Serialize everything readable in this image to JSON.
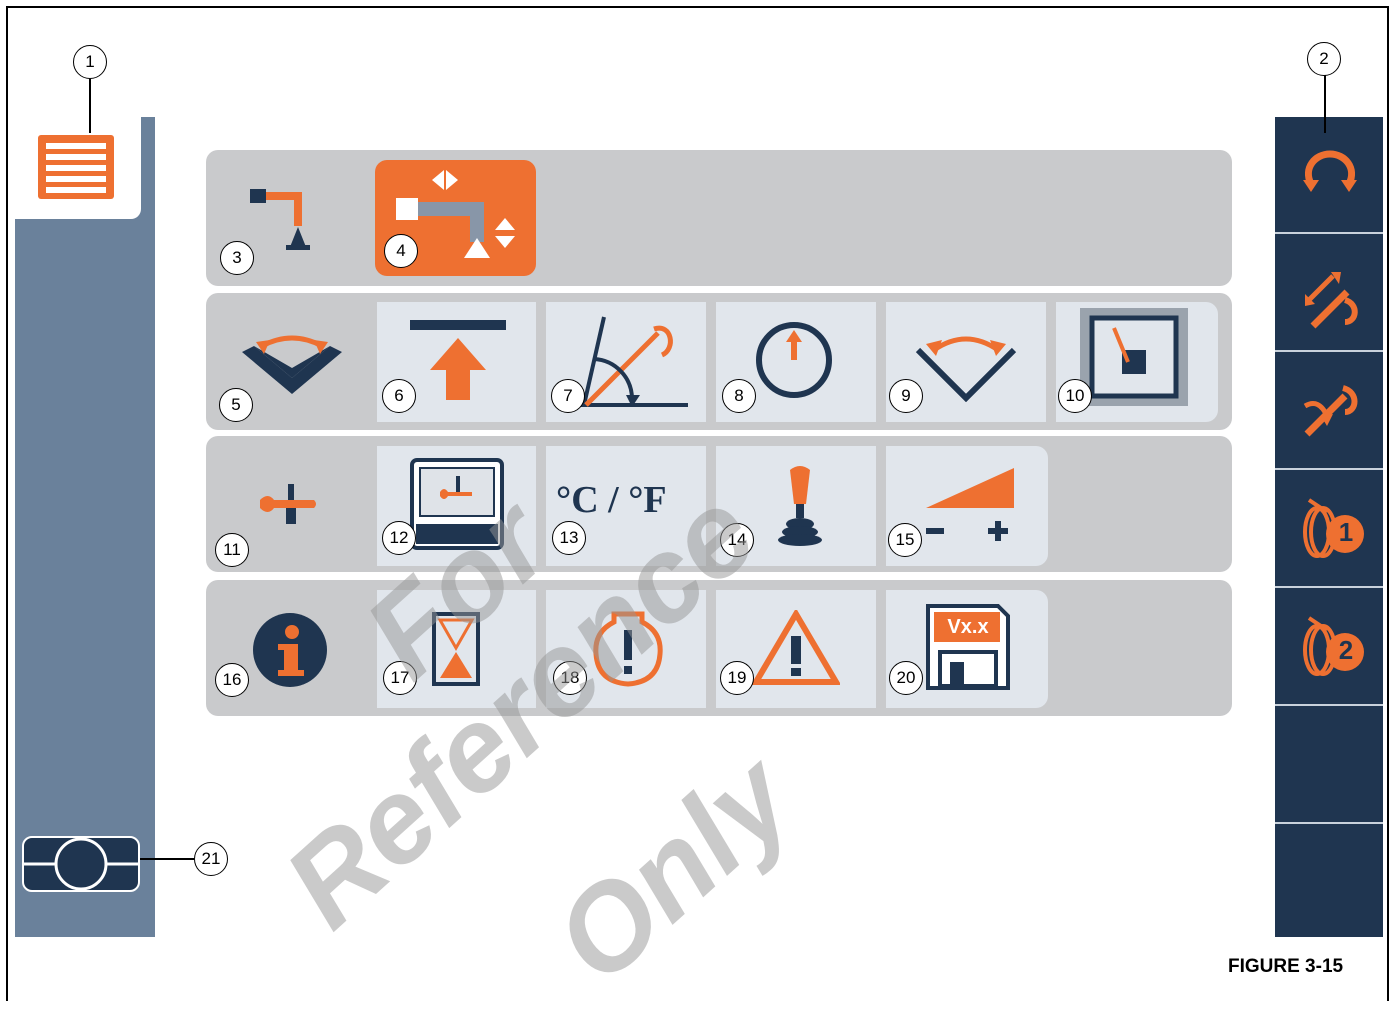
{
  "figure_label": "FIGURE 3-15",
  "watermark": {
    "line1": "For",
    "line2": "Reference",
    "line3": "Only"
  },
  "colors": {
    "orange": "#ee7031",
    "navy": "#1f3550",
    "panel": "#6a819b",
    "row": "#c9cacc",
    "tile": "#e1e6ec"
  },
  "callouts": {
    "c1": "1",
    "c2": "2",
    "c3": "3",
    "c4": "4",
    "c5": "5",
    "c6": "6",
    "c7": "7",
    "c8": "8",
    "c9": "9",
    "c10": "10",
    "c11": "11",
    "c12": "12",
    "c13": "13",
    "c14": "14",
    "c15": "15",
    "c16": "16",
    "c17": "17",
    "c18": "18",
    "c19": "19",
    "c20": "20",
    "c21": "21"
  },
  "menu": {
    "main_menu_icon": "menu-list-icon",
    "footer_icon": "display-layout-icon"
  },
  "rows": [
    {
      "category_icon": "crane-mode-icon",
      "items": [
        "crane-mode-adjust-icon"
      ]
    },
    {
      "category_icon": "limits-category-icon",
      "items": [
        "height-limit-icon",
        "boom-angle-limit-icon",
        "pressure-gauge-icon",
        "swing-limit-icon",
        "working-area-icon"
      ]
    },
    {
      "category_icon": "settings-category-icon",
      "items": [
        "display-settings-icon",
        "temperature-unit-icon",
        "joystick-icon",
        "brightness-icon"
      ]
    },
    {
      "category_icon": "info-category-icon",
      "items": [
        "hourglass-icon",
        "engine-warning-icon",
        "warning-triangle-icon",
        "software-version-icon"
      ]
    }
  ],
  "temperature_units": "°C / °F",
  "software_version": "Vx.x",
  "right_bar": {
    "items": [
      "swing-icon",
      "telescope-icon",
      "boom-hook-icon",
      "winch-1-icon",
      "winch-2-icon"
    ],
    "winch_1_number": "1",
    "winch_2_number": "2"
  }
}
